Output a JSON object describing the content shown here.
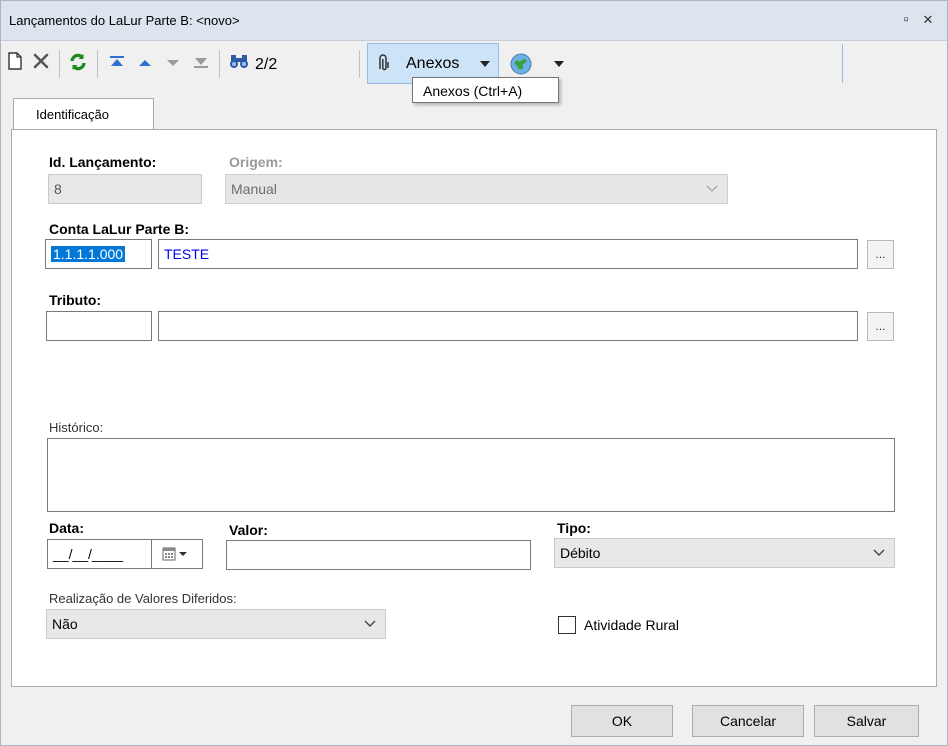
{
  "window": {
    "title": "Lançamentos do LaLur Parte B: <novo>",
    "restore_glyph": "▫",
    "close_glyph": "✕"
  },
  "toolbar": {
    "record_counter": "2/2",
    "anexos_label": "Anexos",
    "tooltip": "Anexos (Ctrl+A)"
  },
  "tabs": [
    {
      "label": "Identificação"
    }
  ],
  "form": {
    "id_lancamento": {
      "label": "Id. Lançamento:",
      "value": "8"
    },
    "origem": {
      "label": "Origem:",
      "value": "Manual"
    },
    "conta": {
      "label": "Conta LaLur Parte B:",
      "code": "1.1.1.1.000",
      "description": "TESTE",
      "lookup_label": "..."
    },
    "tributo": {
      "label": "Tributo:",
      "code": "",
      "description": "",
      "lookup_label": "..."
    },
    "historico": {
      "label": "Histórico:",
      "value": ""
    },
    "data": {
      "label": "Data:",
      "value": "__/__/____"
    },
    "valor": {
      "label": "Valor:",
      "value": ""
    },
    "tipo": {
      "label": "Tipo:",
      "value": "Débito"
    },
    "realizacao": {
      "label": "Realização de Valores Diferidos:",
      "value": "Não"
    },
    "atividade_rural": {
      "label": "Atividade Rural",
      "checked": false
    }
  },
  "buttons": {
    "ok": "OK",
    "cancel": "Cancelar",
    "save": "Salvar"
  },
  "colors": {
    "accent_blue": "#0078d7",
    "description_blue": "#0000ee",
    "titlebar_bg": "#dce4ee"
  }
}
